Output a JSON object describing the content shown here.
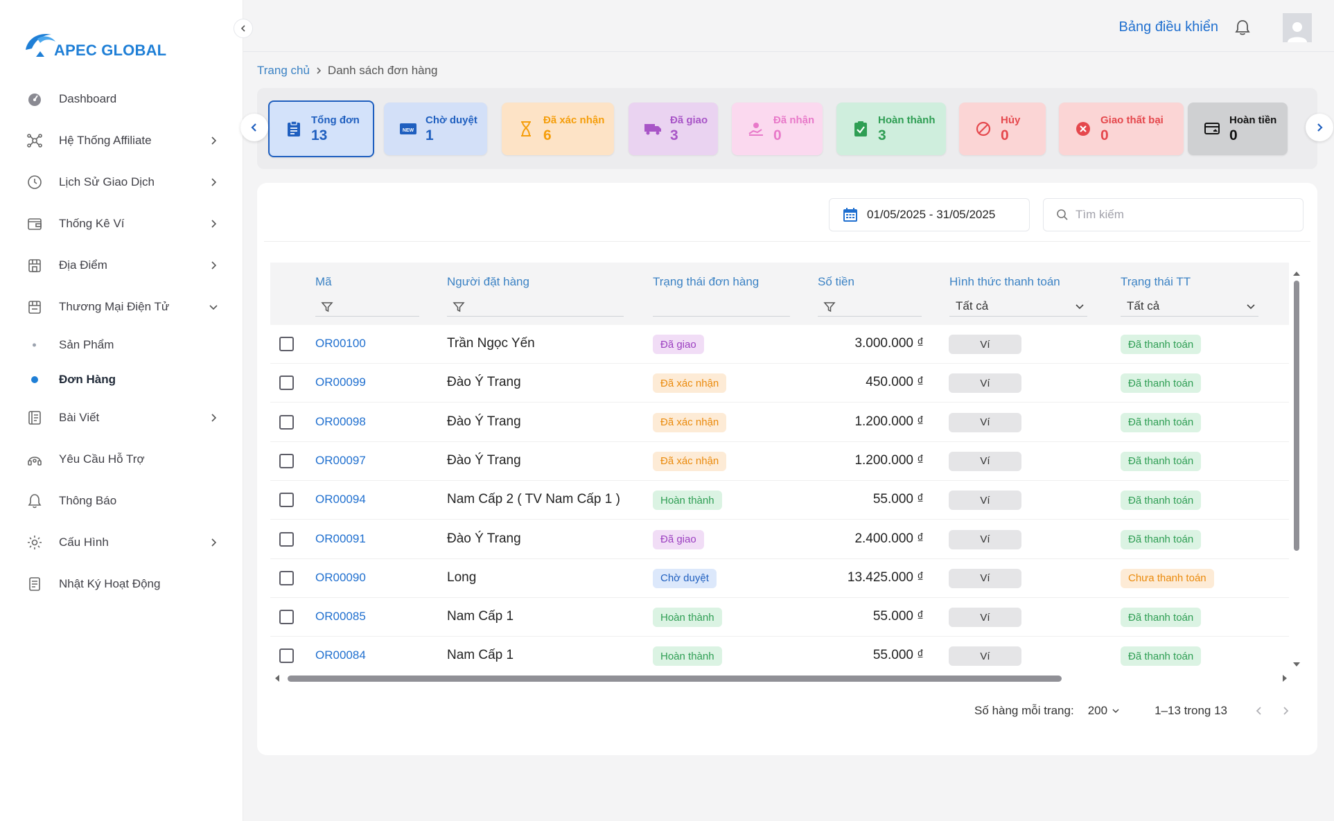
{
  "brand": {
    "name": "APEC GLOBAL"
  },
  "header": {
    "dashboard_link": "Bảng điều khiển"
  },
  "sidebar": {
    "items": [
      {
        "label": "Dashboard",
        "icon": "dashboard-icon",
        "has_children": false
      },
      {
        "label": "Hệ Thống Affiliate",
        "icon": "network-icon",
        "has_children": true
      },
      {
        "label": "Lịch Sử Giao Dịch",
        "icon": "history-icon",
        "has_children": true
      },
      {
        "label": "Thống Kê Ví",
        "icon": "wallet-icon",
        "has_children": true
      },
      {
        "label": "Địa Điểm",
        "icon": "store-icon",
        "has_children": true
      },
      {
        "label": "Thương Mại Điện Tử",
        "icon": "shop-icon",
        "has_children": true,
        "expanded": true,
        "children": [
          {
            "label": "Sản Phẩm",
            "active": false
          },
          {
            "label": "Đơn Hàng",
            "active": true
          }
        ]
      },
      {
        "label": "Bài Viết",
        "icon": "article-icon",
        "has_children": true
      },
      {
        "label": "Yêu Cầu Hỗ Trợ",
        "icon": "support-icon",
        "has_children": false
      },
      {
        "label": "Thông Báo",
        "icon": "bell-icon",
        "has_children": false
      },
      {
        "label": "Cấu Hình",
        "icon": "gear-icon",
        "has_children": true
      },
      {
        "label": "Nhật Ký Hoạt Động",
        "icon": "log-icon",
        "has_children": false
      }
    ]
  },
  "breadcrumb": {
    "home": "Trang chủ",
    "current": "Danh sách đơn hàng"
  },
  "status_cards": [
    {
      "label": "Tổng đơn",
      "count": "13",
      "icon": "clipboard-icon",
      "color": "#1f5fbf",
      "bg": "#d3e2fa",
      "active": true
    },
    {
      "label": "Chờ duyệt",
      "count": "1",
      "icon": "new-badge-icon",
      "color": "#1f5fbf",
      "bg": "#d3e0f8"
    },
    {
      "label": "Đã xác nhận",
      "count": "6",
      "icon": "hourglass-icon",
      "color": "#f59e0b",
      "bg": "#fde3c6"
    },
    {
      "label": "Đã giao",
      "count": "3",
      "icon": "truck-icon",
      "color": "#a855c7",
      "bg": "#ead3f1"
    },
    {
      "label": "Đã nhận",
      "count": "0",
      "icon": "receive-icon",
      "color": "#e879c9",
      "bg": "#fbd9ef"
    },
    {
      "label": "Hoàn thành",
      "count": "3",
      "icon": "check-icon",
      "color": "#2f9e54",
      "bg": "#cfeedd"
    },
    {
      "label": "Hủy",
      "count": "0",
      "icon": "cancel-icon",
      "color": "#e5484d",
      "bg": "#fbd5d5"
    },
    {
      "label": "Giao thất bại",
      "count": "0",
      "icon": "fail-icon",
      "color": "#e5484d",
      "bg": "#fbd5d5"
    },
    {
      "label": "Hoàn tiền",
      "count": "0",
      "icon": "refund-icon",
      "color": "#111111",
      "bg": "#cfd0d2"
    }
  ],
  "filters": {
    "date_range": "01/05/2025 - 31/05/2025",
    "search_placeholder": "Tìm kiếm"
  },
  "table": {
    "columns": {
      "code": "Mã",
      "customer": "Người đặt hàng",
      "order_status": "Trạng thái đơn hàng",
      "amount": "Số tiền",
      "payment_method": "Hình thức thanh toán",
      "payment_status": "Trạng thái TT"
    },
    "payment_method_filter": "Tất cả",
    "payment_status_filter": "Tất cả",
    "rows": [
      {
        "code": "OR00100",
        "customer": "Trần Ngọc Yến",
        "status": "Đã giao",
        "amount": "3.000.000 ₫",
        "method": "Ví",
        "pay_status": "Đã thanh toán"
      },
      {
        "code": "OR00099",
        "customer": "Đào Ý Trang",
        "status": "Đã xác nhận",
        "amount": "450.000 ₫",
        "method": "Ví",
        "pay_status": "Đã thanh toán"
      },
      {
        "code": "OR00098",
        "customer": "Đào Ý Trang",
        "status": "Đã xác nhận",
        "amount": "1.200.000 ₫",
        "method": "Ví",
        "pay_status": "Đã thanh toán"
      },
      {
        "code": "OR00097",
        "customer": "Đào Ý Trang",
        "status": "Đã xác nhận",
        "amount": "1.200.000 ₫",
        "method": "Ví",
        "pay_status": "Đã thanh toán"
      },
      {
        "code": "OR00094",
        "customer": "Nam Cấp 2 ( TV Nam Cấp 1 )",
        "status": "Hoàn thành",
        "amount": "55.000 ₫",
        "method": "Ví",
        "pay_status": "Đã thanh toán"
      },
      {
        "code": "OR00091",
        "customer": "Đào Ý Trang",
        "status": "Đã giao",
        "amount": "2.400.000 ₫",
        "method": "Ví",
        "pay_status": "Đã thanh toán"
      },
      {
        "code": "OR00090",
        "customer": "Long",
        "status": "Chờ duyệt",
        "amount": "13.425.000 ₫",
        "method": "Ví",
        "pay_status": "Chưa thanh toán"
      },
      {
        "code": "OR00085",
        "customer": "Nam Cấp 1",
        "status": "Hoàn thành",
        "amount": "55.000 ₫",
        "method": "Ví",
        "pay_status": "Đã thanh toán"
      },
      {
        "code": "OR00084",
        "customer": "Nam Cấp 1",
        "status": "Hoàn thành",
        "amount": "55.000 ₫",
        "method": "Ví",
        "pay_status": "Đã thanh toán"
      }
    ]
  },
  "status_styles": {
    "Đã giao": {
      "color": "#9b3fc0",
      "bg": "#f1ddf6"
    },
    "Đã xác nhận": {
      "color": "#ea8a0c",
      "bg": "#fdebd6"
    },
    "Hoàn thành": {
      "color": "#2f9e54",
      "bg": "#dbf3e3"
    },
    "Chờ duyệt": {
      "color": "#1f5fbf",
      "bg": "#dce8fb"
    },
    "Đã thanh toán": {
      "color": "#2f9e54",
      "bg": "#dbf3e3"
    },
    "Chưa thanh toán": {
      "color": "#ea8a0c",
      "bg": "#fdebd6"
    }
  },
  "pagination": {
    "rows_per_page_label": "Số hàng mỗi trang:",
    "rows_per_page": "200",
    "range": "1–13 trong 13"
  }
}
